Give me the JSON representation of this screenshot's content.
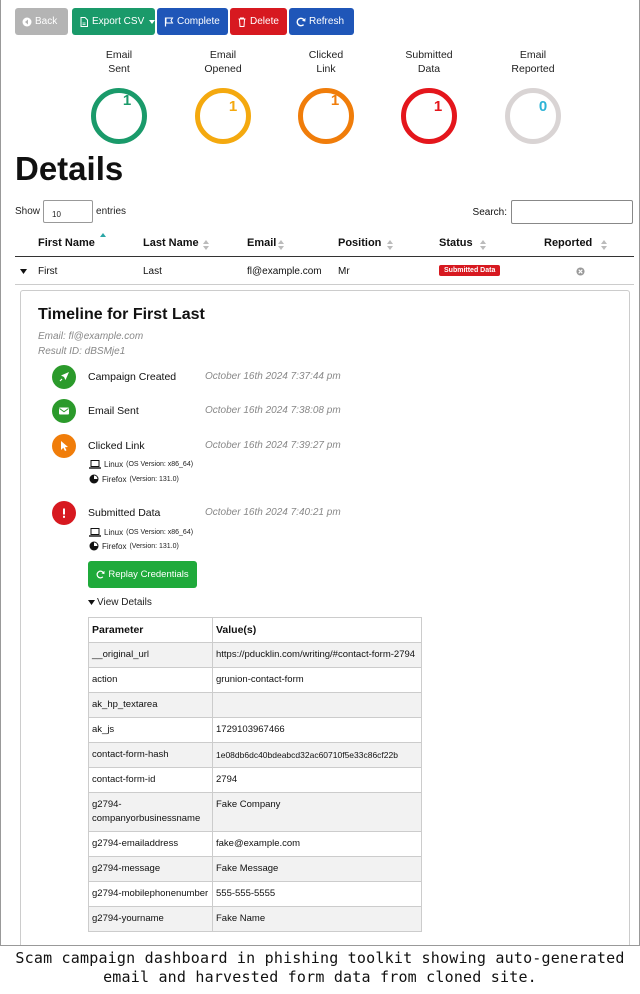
{
  "toolbar": {
    "back_label": "Back",
    "export_label": "Export CSV",
    "complete_label": "Complete",
    "delete_label": "Delete",
    "refresh_label": "Refresh"
  },
  "stats": [
    {
      "line1": "Email",
      "line2": "Sent",
      "value": "1",
      "color": "#1a9a6a"
    },
    {
      "line1": "Email",
      "line2": "Opened",
      "value": "1",
      "color": "#f4a90f"
    },
    {
      "line1": "Clicked",
      "line2": "Link",
      "value": "1",
      "color": "#f07d0a"
    },
    {
      "line1": "Submitted",
      "line2": "Data",
      "value": "1",
      "color": "#e4161c"
    },
    {
      "line1": "Email",
      "line2": "Reported",
      "value": "0",
      "color": "#2db3d6"
    }
  ],
  "details_title": "Details",
  "table_controls": {
    "show_label": "Show",
    "show_value": "10",
    "entries_label": "entries",
    "search_label": "Search:"
  },
  "table": {
    "headers": [
      "First Name",
      "Last Name",
      "Email",
      "Position",
      "Status",
      "Reported"
    ],
    "row": {
      "first": "First",
      "last": "Last",
      "email": "fl@example.com",
      "position": "Mr",
      "status": "Submitted Data"
    }
  },
  "timeline": {
    "title": "Timeline for First Last",
    "email_line": "Email: fl@example.com",
    "result_line": "Result ID: dBSMje1",
    "events": [
      {
        "name": "Campaign Created",
        "time": "October 16th 2024 7:37:44 pm",
        "color": "#2b9a2b",
        "icon": "rocket-icon"
      },
      {
        "name": "Email Sent",
        "time": "October 16th 2024 7:38:08 pm",
        "color": "#2b9a2b",
        "icon": "envelope-icon"
      },
      {
        "name": "Clicked Link",
        "time": "October 16th 2024 7:39:27 pm",
        "color": "#f07d0a",
        "icon": "pointer-icon"
      },
      {
        "name": "Submitted Data",
        "time": "October 16th 2024 7:40:21 pm",
        "color": "#d71920",
        "icon": "exclamation-icon"
      }
    ],
    "os_label": "Linux",
    "os_version": "(OS Version: x86_64)",
    "browser_label": "Firefox",
    "browser_version": "(Version: 131.0)",
    "replay_label": "Replay Credentials",
    "view_details_label": "View Details"
  },
  "params": {
    "col1": "Parameter",
    "col2": "Value(s)",
    "rows": [
      {
        "p": "__original_url",
        "v": "https://pducklin.com/writing/#contact-form-2794"
      },
      {
        "p": "action",
        "v": "grunion-contact-form"
      },
      {
        "p": "ak_hp_textarea",
        "v": ""
      },
      {
        "p": "ak_js",
        "v": "1729103967466"
      },
      {
        "p": "contact-form-hash",
        "v": "1e08db6dc40bdeabcd32ac60710f5e33c86cf22b"
      },
      {
        "p": "contact-form-id",
        "v": "2794"
      },
      {
        "p": "g2794-companyorbusinessname",
        "v": "Fake Company"
      },
      {
        "p": "g2794-emailaddress",
        "v": "fake@example.com"
      },
      {
        "p": "g2794-message",
        "v": "Fake Message"
      },
      {
        "p": "g2794-mobilephonenumber",
        "v": "555-555-5555"
      },
      {
        "p": "g2794-yourname",
        "v": "Fake Name"
      }
    ]
  },
  "caption": "Scam campaign dashboard in phishing toolkit showing auto-generated email and harvested form data from cloned site."
}
